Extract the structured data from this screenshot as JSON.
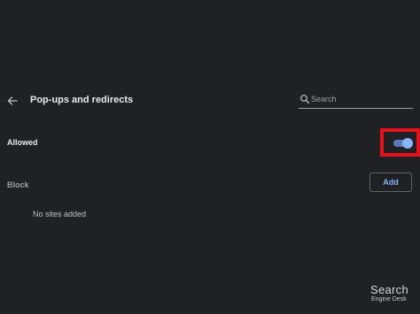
{
  "header": {
    "title": "Pop-ups and redirects",
    "back_icon": "arrow-left-icon",
    "search_placeholder": "Search",
    "search_value": "",
    "search_icon": "magnifier-icon"
  },
  "allowed": {
    "label": "Allowed",
    "toggle_on": true
  },
  "block": {
    "label": "Block",
    "add_label": "Add"
  },
  "empty_message": "No sites added",
  "watermark": {
    "line1": "Search",
    "line2": "Engine Desk"
  },
  "colors": {
    "background": "#202124",
    "accent": "#8ab4f8",
    "toggle_track": "#5b79b8",
    "highlight": "#e8101a"
  }
}
